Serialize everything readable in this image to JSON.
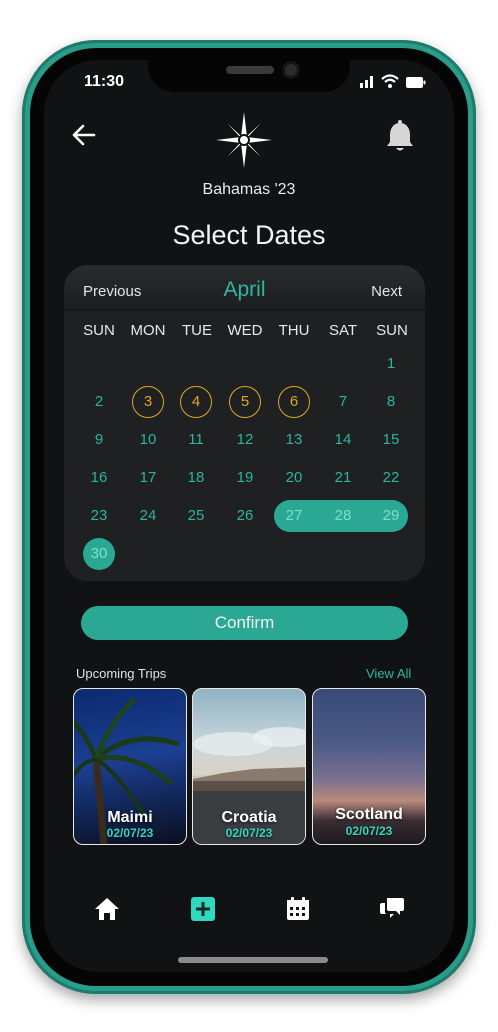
{
  "status": {
    "time": "11:30"
  },
  "header": {
    "trip_name": "Bahamas '23",
    "title": "Select Dates"
  },
  "calendar": {
    "prev_label": "Previous",
    "month": "April",
    "next_label": "Next",
    "weekdays": [
      "SUN",
      "MON",
      "TUE",
      "WED",
      "THU",
      "SAT",
      "SUN"
    ],
    "days": [
      "1",
      "2",
      "3",
      "4",
      "5",
      "6",
      "7",
      "8",
      "9",
      "10",
      "11",
      "12",
      "13",
      "14",
      "15",
      "16",
      "17",
      "18",
      "19",
      "20",
      "21",
      "22",
      "23",
      "24",
      "25",
      "26",
      "27",
      "28",
      "29",
      "30"
    ],
    "circled_days": [
      "3",
      "4",
      "5",
      "6"
    ],
    "selected_range": [
      "27",
      "28",
      "29",
      "30"
    ]
  },
  "confirm_label": "Confirm",
  "upcoming": {
    "label": "Upcoming Trips",
    "view_all": "View All",
    "trips": [
      {
        "name": "Maimi",
        "date": "02/07/23"
      },
      {
        "name": "Croatia",
        "date": "02/07/23"
      },
      {
        "name": "Scotland",
        "date": "02/07/23"
      }
    ]
  },
  "nav": {
    "icons": [
      "home-icon",
      "add-icon",
      "calendar-icon",
      "chat-icon"
    ]
  },
  "colors": {
    "accent": "#2aa894",
    "accent_text": "#2bb8a2",
    "ring": "#e0a81e",
    "background": "#111214",
    "frame": "#2a9d8a"
  }
}
